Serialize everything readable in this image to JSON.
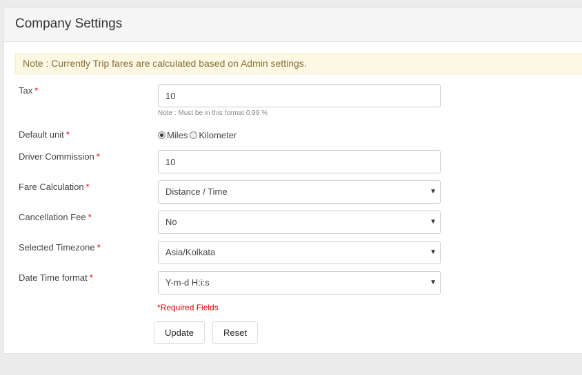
{
  "header": {
    "title": "Company Settings"
  },
  "note": {
    "text": "Note : Currently Trip fares are calculated based on Admin settings."
  },
  "form": {
    "tax": {
      "label": "Tax",
      "required": "*",
      "value": "10",
      "hint": "Note : Must be in this format 0.99 %"
    },
    "default_unit": {
      "label": "Default unit",
      "required": "*",
      "options": [
        {
          "label": "Miles",
          "checked": true
        },
        {
          "label": "Kilometer",
          "checked": false
        }
      ]
    },
    "driver_commission": {
      "label": "Driver Commission",
      "required": "*",
      "value": "10"
    },
    "fare_calculation": {
      "label": "Fare Calculation",
      "required": "*",
      "selected": "Distance / Time"
    },
    "cancellation_fee": {
      "label": "Cancellation Fee",
      "required": "*",
      "selected": "No"
    },
    "timezone": {
      "label": "Selected Timezone",
      "required": "*",
      "selected": "Asia/Kolkata"
    },
    "datetime_format": {
      "label": "Date Time format",
      "required": "*",
      "selected": "Y-m-d H:i:s"
    },
    "required_fields_text": "*Required Fields"
  },
  "actions": {
    "update_label": "Update",
    "reset_label": "Reset"
  },
  "icons": {
    "select_caret": "caret-down-icon"
  },
  "colors": {
    "required": "#e00000",
    "note_bg": "#fcf8e3",
    "note_text": "#8a6d3b"
  }
}
